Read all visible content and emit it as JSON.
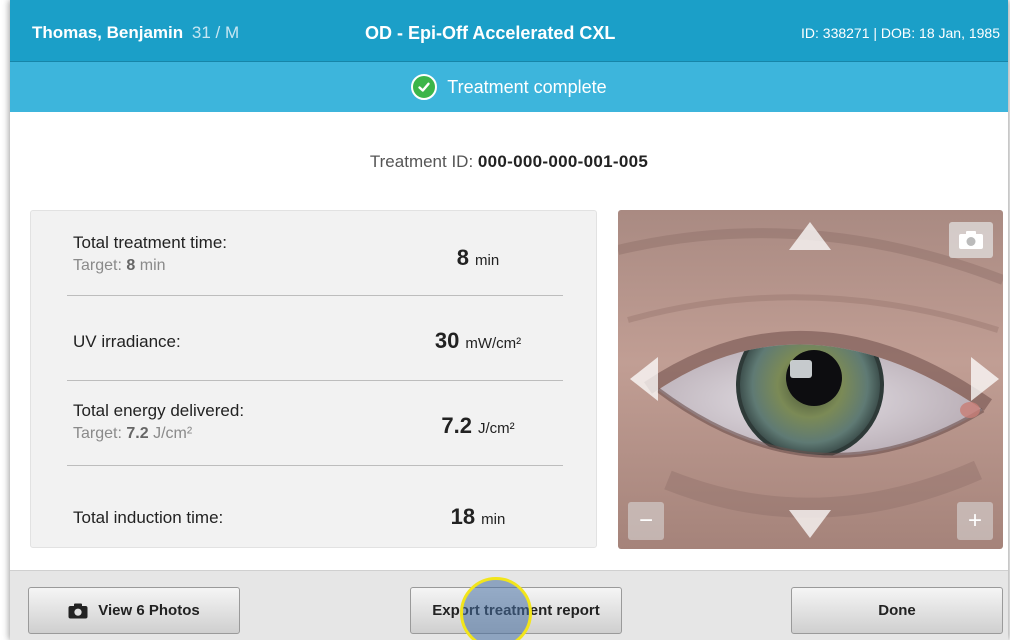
{
  "header": {
    "patient_name": "Thomas, Benjamin",
    "patient_age_sex": "31 / M",
    "procedure": "OD - Epi-Off Accelerated CXL",
    "ids": "ID: 338271 | DOB: 18 Jan, 1985"
  },
  "status": {
    "text": "Treatment complete",
    "icon": "check-circle-icon",
    "color": "#3cb54a"
  },
  "treatment": {
    "label": "Treatment ID:",
    "value": "000-000-000-001-005"
  },
  "stats": [
    {
      "label": "Total treatment time:",
      "target_label": "Target:",
      "target_value": "8",
      "target_unit": "min",
      "value": "8",
      "unit": "min"
    },
    {
      "label": "UV irradiance:",
      "value": "30",
      "unit": "mW/cm²"
    },
    {
      "label": "Total energy delivered:",
      "target_label": "Target:",
      "target_value": "7.2",
      "target_unit": "J/cm²",
      "value": "7.2",
      "unit": "J/cm²"
    },
    {
      "label": "Total induction time:",
      "value": "18",
      "unit": "min"
    }
  ],
  "camera": {
    "controls": [
      "camera-icon",
      "arrow-up-icon",
      "arrow-down-icon",
      "arrow-left-icon",
      "arrow-right-icon",
      "zoom-out-icon",
      "zoom-in-icon"
    ],
    "zoom_out": "−",
    "zoom_in": "+"
  },
  "footer": {
    "photos_label": "View 6 Photos",
    "export_label": "Export treatment report",
    "done_label": "Done"
  },
  "colors": {
    "header": "#1b9fc8",
    "status_bar": "#3db5dc",
    "cursor_ring": "#f2e51b"
  }
}
